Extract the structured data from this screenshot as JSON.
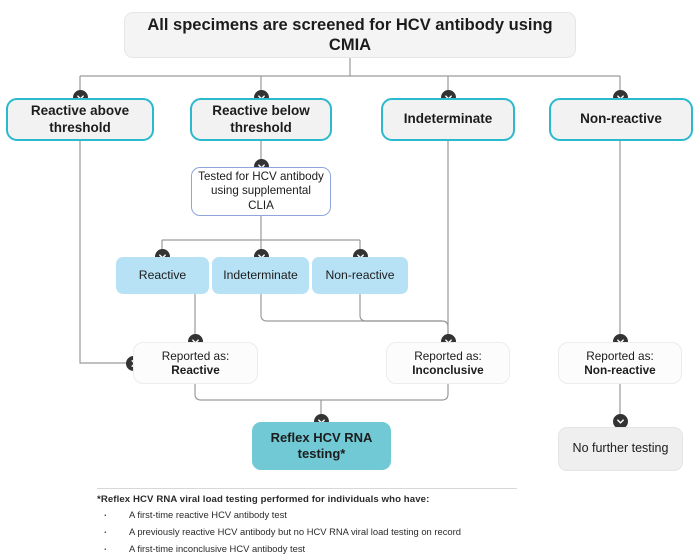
{
  "header": {
    "title": "All specimens are screened for HCV antibody using CMIA"
  },
  "tier1": {
    "reactive_above": "Reactive above threshold",
    "reactive_below": "Reactive below threshold",
    "indeterminate": "Indeterminate",
    "non_reactive": "Non-reactive"
  },
  "supplemental": {
    "label": "Tested for HCV antibody using supplemental CLIA"
  },
  "clia_results": {
    "reactive": "Reactive",
    "indeterminate": "Indeterminate",
    "non_reactive": "Non-reactive"
  },
  "reported": {
    "prefix": "Reported as:",
    "reactive": "Reactive",
    "inconclusive": "Inconclusive",
    "non_reactive": "Non-reactive"
  },
  "outcomes": {
    "reflex": "Reflex HCV RNA testing*",
    "reflex_line1": "Reflex HCV RNA",
    "reflex_line2": "testing*",
    "no_further": "No further testing"
  },
  "footnote": {
    "heading": "*Reflex HCV RNA viral load testing performed for individuals who have:",
    "bullets": [
      "A first-time reactive HCV antibody test",
      "A previously reactive HCV antibody but no HCV RNA viral load testing on record",
      "A first-time inconclusive HCV antibody test"
    ]
  },
  "colors": {
    "teal_border": "#2bb9cd",
    "teal_fill": "#70c9d5",
    "light_blue": "#b7e2f6",
    "periwinkle": "#8ea6dd",
    "grey_fill": "#efefef",
    "box_grey": "#f2f2f2",
    "connector": "#9a9a9a",
    "marker": "#333333"
  },
  "icons": {
    "down_arrow": "chevron-down-icon",
    "right_arrow": "chevron-right-icon"
  }
}
